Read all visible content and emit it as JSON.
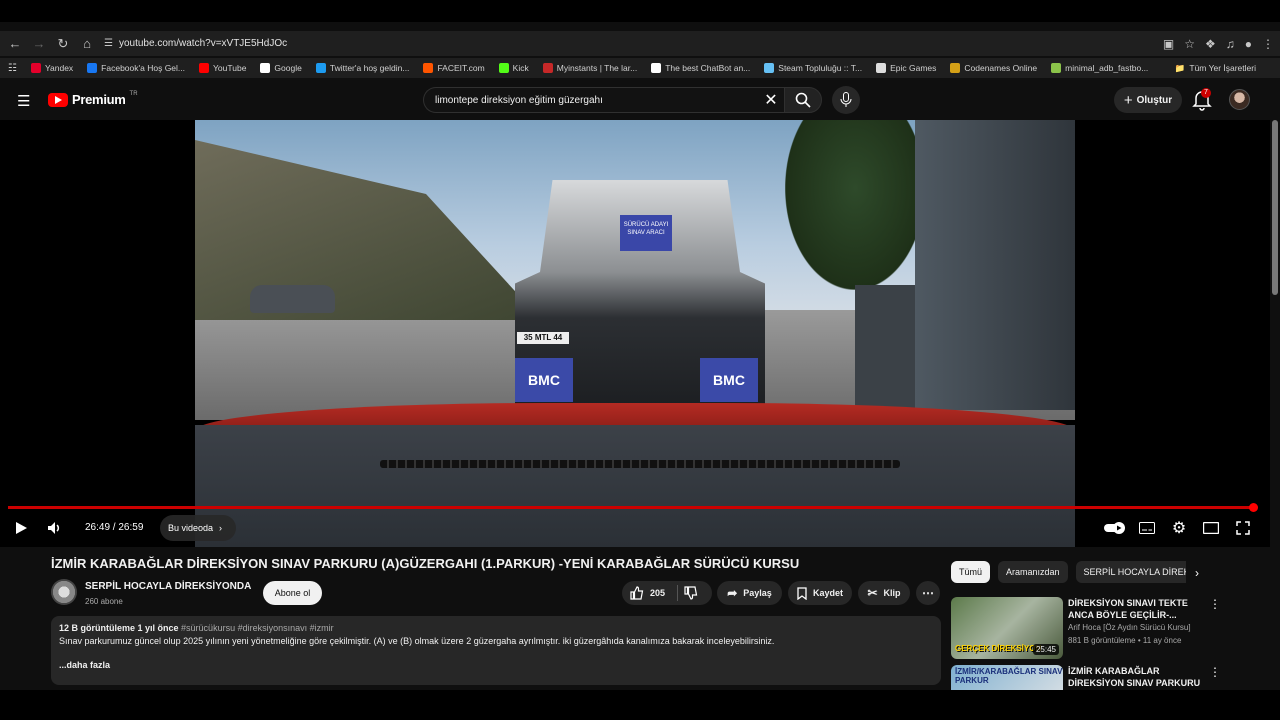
{
  "browser": {
    "url": "youtube.com/watch?v=xVTJE5HdJOc",
    "bookmarks": [
      {
        "label": "Yandex",
        "color": "#e4002b"
      },
      {
        "label": "Facebook'a Hoş Gel...",
        "color": "#1877f2"
      },
      {
        "label": "YouTube",
        "color": "#ff0000"
      },
      {
        "label": "Google",
        "color": "#ffffff"
      },
      {
        "label": "Twitter'a hoş geldin...",
        "color": "#1d9bf0"
      },
      {
        "label": "FACEIT.com",
        "color": "#ff5500"
      },
      {
        "label": "Kick",
        "color": "#53fc18"
      },
      {
        "label": "Myinstants | The lar...",
        "color": "#c62828"
      },
      {
        "label": "The best ChatBot an...",
        "color": "#ffffff"
      },
      {
        "label": "Steam Topluluğu :: T...",
        "color": "#66c0f4"
      },
      {
        "label": "Epic Games",
        "color": "#dddddd"
      },
      {
        "label": "Codenames Online",
        "color": "#d4a017"
      },
      {
        "label": "minimal_adb_fastbo...",
        "color": "#8bc34a"
      }
    ],
    "all_bookmarks_label": "Tüm Yer İşaretleri"
  },
  "header": {
    "logo_text": "Premium",
    "logo_region": "TR",
    "search_value": "limontepe direksiyon eğitim güzergahı",
    "create_label": "Oluştur",
    "notification_count": "7"
  },
  "video": {
    "sign_text": "SÜRÜCÜ ADAYI SINAV ARACI",
    "plate_text": "35 MTL 44",
    "mudflap_text": "BMC"
  },
  "player": {
    "progress": 0.994,
    "time_text": "26:49 / 26:59",
    "chapter_label": "Bu videoda"
  },
  "info": {
    "title": "İZMİR KARABAĞLAR DİREKSİYON SINAV PARKURU (A)GÜZERGAHI (1.PARKUR) -YENİ KARABAĞLAR SÜRÜCÜ KURSU",
    "channel_name": "SERPİL HOCAYLA DİREKSİYONDA",
    "subscribers": "260 abone",
    "subscribe_label": "Abone ol",
    "likes": "205",
    "share_label": "Paylaş",
    "save_label": "Kaydet",
    "clip_label": "Klip"
  },
  "description": {
    "views_date": "12 B görüntüleme  1 yıl önce",
    "tags": "#sürücükursu #direksiyonsınavı #izmir",
    "text": "Sınav parkurumuz  güncel olup 2025 yılının yeni yönetmeliğine göre çekilmiştir. (A) ve (B) olmak üzere 2 güzergaha ayrılmıştır. iki güzergâhıda kanalımıza bakarak inceleyebilirsiniz.",
    "more_label": "...daha fazla"
  },
  "chips": [
    "Tümü",
    "Aramanızdan",
    "SERPİL HOCAYLA DİREK"
  ],
  "recommendations": [
    {
      "title": "DİREKSİYON SINAVI TEKTE ANCA BÖYLE GEÇİLİR-...",
      "channel": "Arif Hoca [Öz Aydın Sürücü Kursu]",
      "meta": "881 B görüntüleme • 11 ay önce",
      "duration": "25:45",
      "thumb_caption": "GERÇEK DİREKSİYON"
    },
    {
      "title": "İZMİR KARABAĞLAR DİREKSİYON SINAV PARKURU ...",
      "channel": "",
      "meta": "",
      "duration": "",
      "thumb_caption": "İZMİR/KARABAĞLAR SINAV PARKUR"
    }
  ]
}
